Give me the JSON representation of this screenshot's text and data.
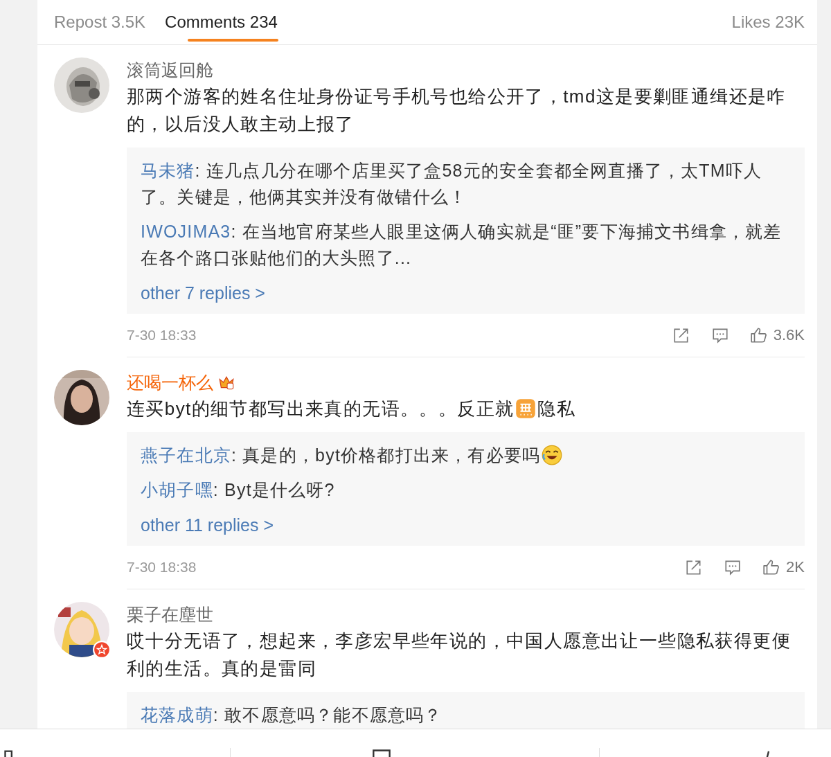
{
  "tabs": [
    {
      "label": "Repost 3.5K",
      "selected": false
    },
    {
      "label": "Comments 234",
      "selected": true
    },
    {
      "label": "Likes 23K",
      "selected": false
    }
  ],
  "comments": [
    {
      "user": "滚筒返回舱",
      "vip": false,
      "name_badge": false,
      "avatar_badge": false,
      "body": [
        {
          "kind": "text",
          "text": "那两个游客的姓名住址身份证号手机号也给公开了，tmd这是要剿匪通缉还是咋的，以后没人敢主动上报了"
        }
      ],
      "replies": [
        {
          "user": "马未猪",
          "body": [
            {
              "kind": "text",
              "text": ": 连几点几分在哪个店里买了盒58元的安全套都全网直播了，太TM吓人了。关键是，他俩其实并没有做错什么！"
            }
          ]
        },
        {
          "user": "IWOJIMA3",
          "body": [
            {
              "kind": "text",
              "text": ": 在当地官府某些人眼里这俩人确实就是“匪”要下海捕文书缉拿，就差在各个路口张贴他们的大头照了..."
            }
          ]
        }
      ],
      "more": "other 7 replies >",
      "time": "7-30 18:33",
      "likes": "3.6K"
    },
    {
      "user": "还喝一杯么",
      "vip": true,
      "name_badge": true,
      "avatar_badge": false,
      "body": [
        {
          "kind": "text",
          "text": "连买byt的细节都写出来真的无语。。。反正就"
        },
        {
          "kind": "square-emoji"
        },
        {
          "kind": "text",
          "text": "隐私"
        }
      ],
      "replies": [
        {
          "user": "燕子在北京",
          "body": [
            {
              "kind": "text",
              "text": ": 真是的，byt价格都打出来，有必要吗"
            },
            {
              "kind": "laughing-emoji"
            }
          ]
        },
        {
          "user": "小胡子嘿",
          "body": [
            {
              "kind": "text",
              "text": ": Byt是什么呀?"
            }
          ]
        }
      ],
      "more": "other 11 replies >",
      "time": "7-30 18:38",
      "likes": "2K"
    },
    {
      "user": "栗子在塵世",
      "vip": false,
      "name_badge": false,
      "avatar_badge": true,
      "body": [
        {
          "kind": "text",
          "text": "哎十分无语了，想起来，李彦宏早些年说的，中国人愿意出让一些隐私获得更便利的生活。真的是雷同"
        }
      ],
      "replies": [
        {
          "user": "花落成萌",
          "body": [
            {
              "kind": "text",
              "text": ": 敢不愿意吗？能不愿意吗？"
            }
          ]
        }
      ]
    }
  ]
}
